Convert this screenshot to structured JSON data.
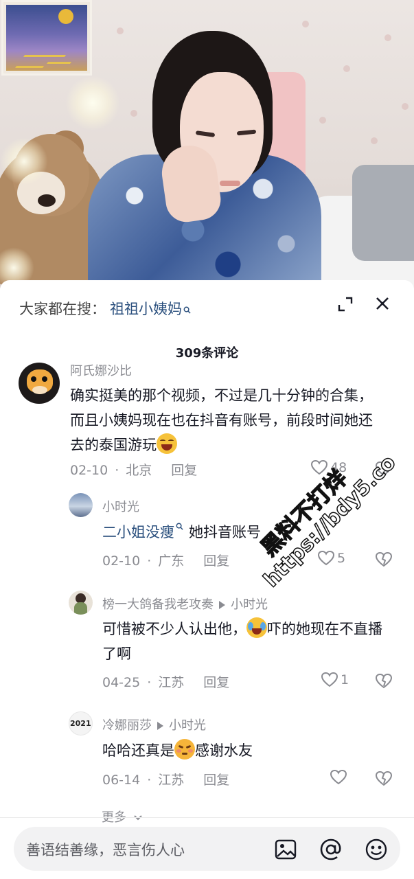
{
  "search_bar": {
    "prefix": "大家都在搜：",
    "term": "祖祖小姨妈"
  },
  "comment_count": "309条评论",
  "comments": [
    {
      "username": "阿氏娜沙比",
      "text": "确实挺美的那个视频，不过是几十分钟的合集，而且小姨妈现在也在抖音有账号，前段时间她还去的泰国游玩",
      "date": "02-10",
      "location": "北京",
      "reply_label": "回复",
      "likes": "48"
    },
    {
      "username": "小时光",
      "link_text": "二小姐没瘦",
      "text": "她抖音账号",
      "date": "02-10",
      "location": "广东",
      "reply_label": "回复",
      "likes": "5"
    },
    {
      "username": "榜一大鸽备我老攻奏",
      "reply_to": "小时光",
      "text_part1": "可惜被不少人认出他，",
      "text_part2": "吓的她现在不直播了啊",
      "date": "04-25",
      "location": "江苏",
      "reply_label": "回复",
      "likes": "1"
    },
    {
      "username": "冷娜丽莎",
      "avatar_text": "2021",
      "reply_to": "小时光",
      "text_part1": "哈哈还真是",
      "text_part2": "感谢水友",
      "date": "06-14",
      "location": "江苏",
      "reply_label": "回复",
      "likes": ""
    }
  ],
  "more_replies": "更多",
  "input": {
    "placeholder": "善语结善缘，恶言伤人心"
  },
  "watermark": {
    "line1": "黑料不打烊",
    "line2": "https://bdy5.co"
  },
  "colors": {
    "link": "#2a4f7d",
    "muted": "#8a8b91",
    "text": "#161823"
  }
}
